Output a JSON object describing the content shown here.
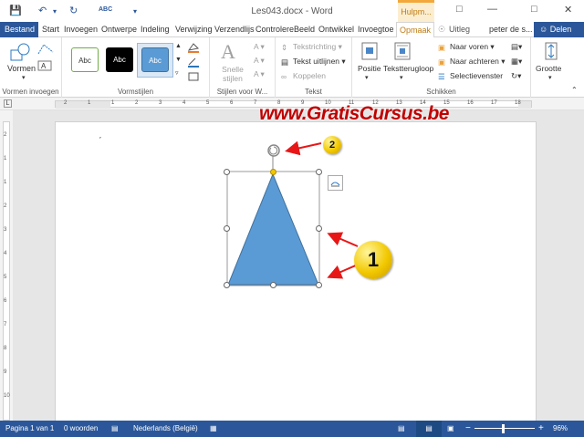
{
  "titlebar": {
    "save_icon": "save-icon",
    "undo_icon": "undo-icon",
    "redo_icon": "redo-icon",
    "spelling_icon": "spelling-icon",
    "title": "Les043.docx - Word",
    "contextual_group": "Hulpm...",
    "help_icon": "question-icon"
  },
  "tabs": {
    "file": "Bestand",
    "items": [
      "Start",
      "Invoegen",
      "Ontwerpe",
      "Indeling",
      "Verwijzing",
      "Verzendlijs",
      "Controlere",
      "Beeld",
      "Ontwikkel",
      "Invoegtoe",
      "Opmaak"
    ],
    "tell_me": "Uitleg",
    "user": "peter de s...",
    "share": "Delen"
  },
  "ribbon": {
    "insert_shapes": {
      "shapes_label": "Vormen",
      "group_label": "Vormen invoegen"
    },
    "shape_styles": {
      "styles": [
        "Abc",
        "Abc",
        "Abc"
      ],
      "group_label": "Vormstijlen"
    },
    "wordart": {
      "quick_styles_label": "Snelle stijlen",
      "group_label": "Stijlen voor W..."
    },
    "text": {
      "direction_label": "Tekstrichting",
      "align_label": "Tekst uitlijnen",
      "link_label": "Koppelen",
      "group_label": "Tekst"
    },
    "arrange": {
      "position_label": "Positie",
      "wrap_label": "Tekstterugloop",
      "forward_label": "Naar voren",
      "backward_label": "Naar achteren",
      "selection_pane_label": "Selectievenster",
      "group_label": "Schikken"
    },
    "size": {
      "size_label": "Grootte"
    }
  },
  "ruler": {
    "h_numbers": [
      "2",
      "1",
      "1",
      "2",
      "3",
      "4",
      "5",
      "6",
      "7",
      "8",
      "9",
      "10",
      "11",
      "12",
      "13",
      "14",
      "15",
      "16",
      "17",
      "18"
    ],
    "v_numbers": [
      "2",
      "1",
      "1",
      "2",
      "3",
      "4",
      "5",
      "6",
      "7",
      "8",
      "9",
      "10"
    ]
  },
  "document": {
    "watermark": "www.GratisCursus.be",
    "annotations": [
      "1",
      "2"
    ],
    "shape_fill": "#5b9bd5",
    "arrow_color": "#e81717"
  },
  "statusbar": {
    "page": "Pagina 1 van 1",
    "words": "0 woorden",
    "language": "Nederlands (België)",
    "zoom": "96%",
    "zoom_minus": "−",
    "zoom_plus": "+"
  }
}
